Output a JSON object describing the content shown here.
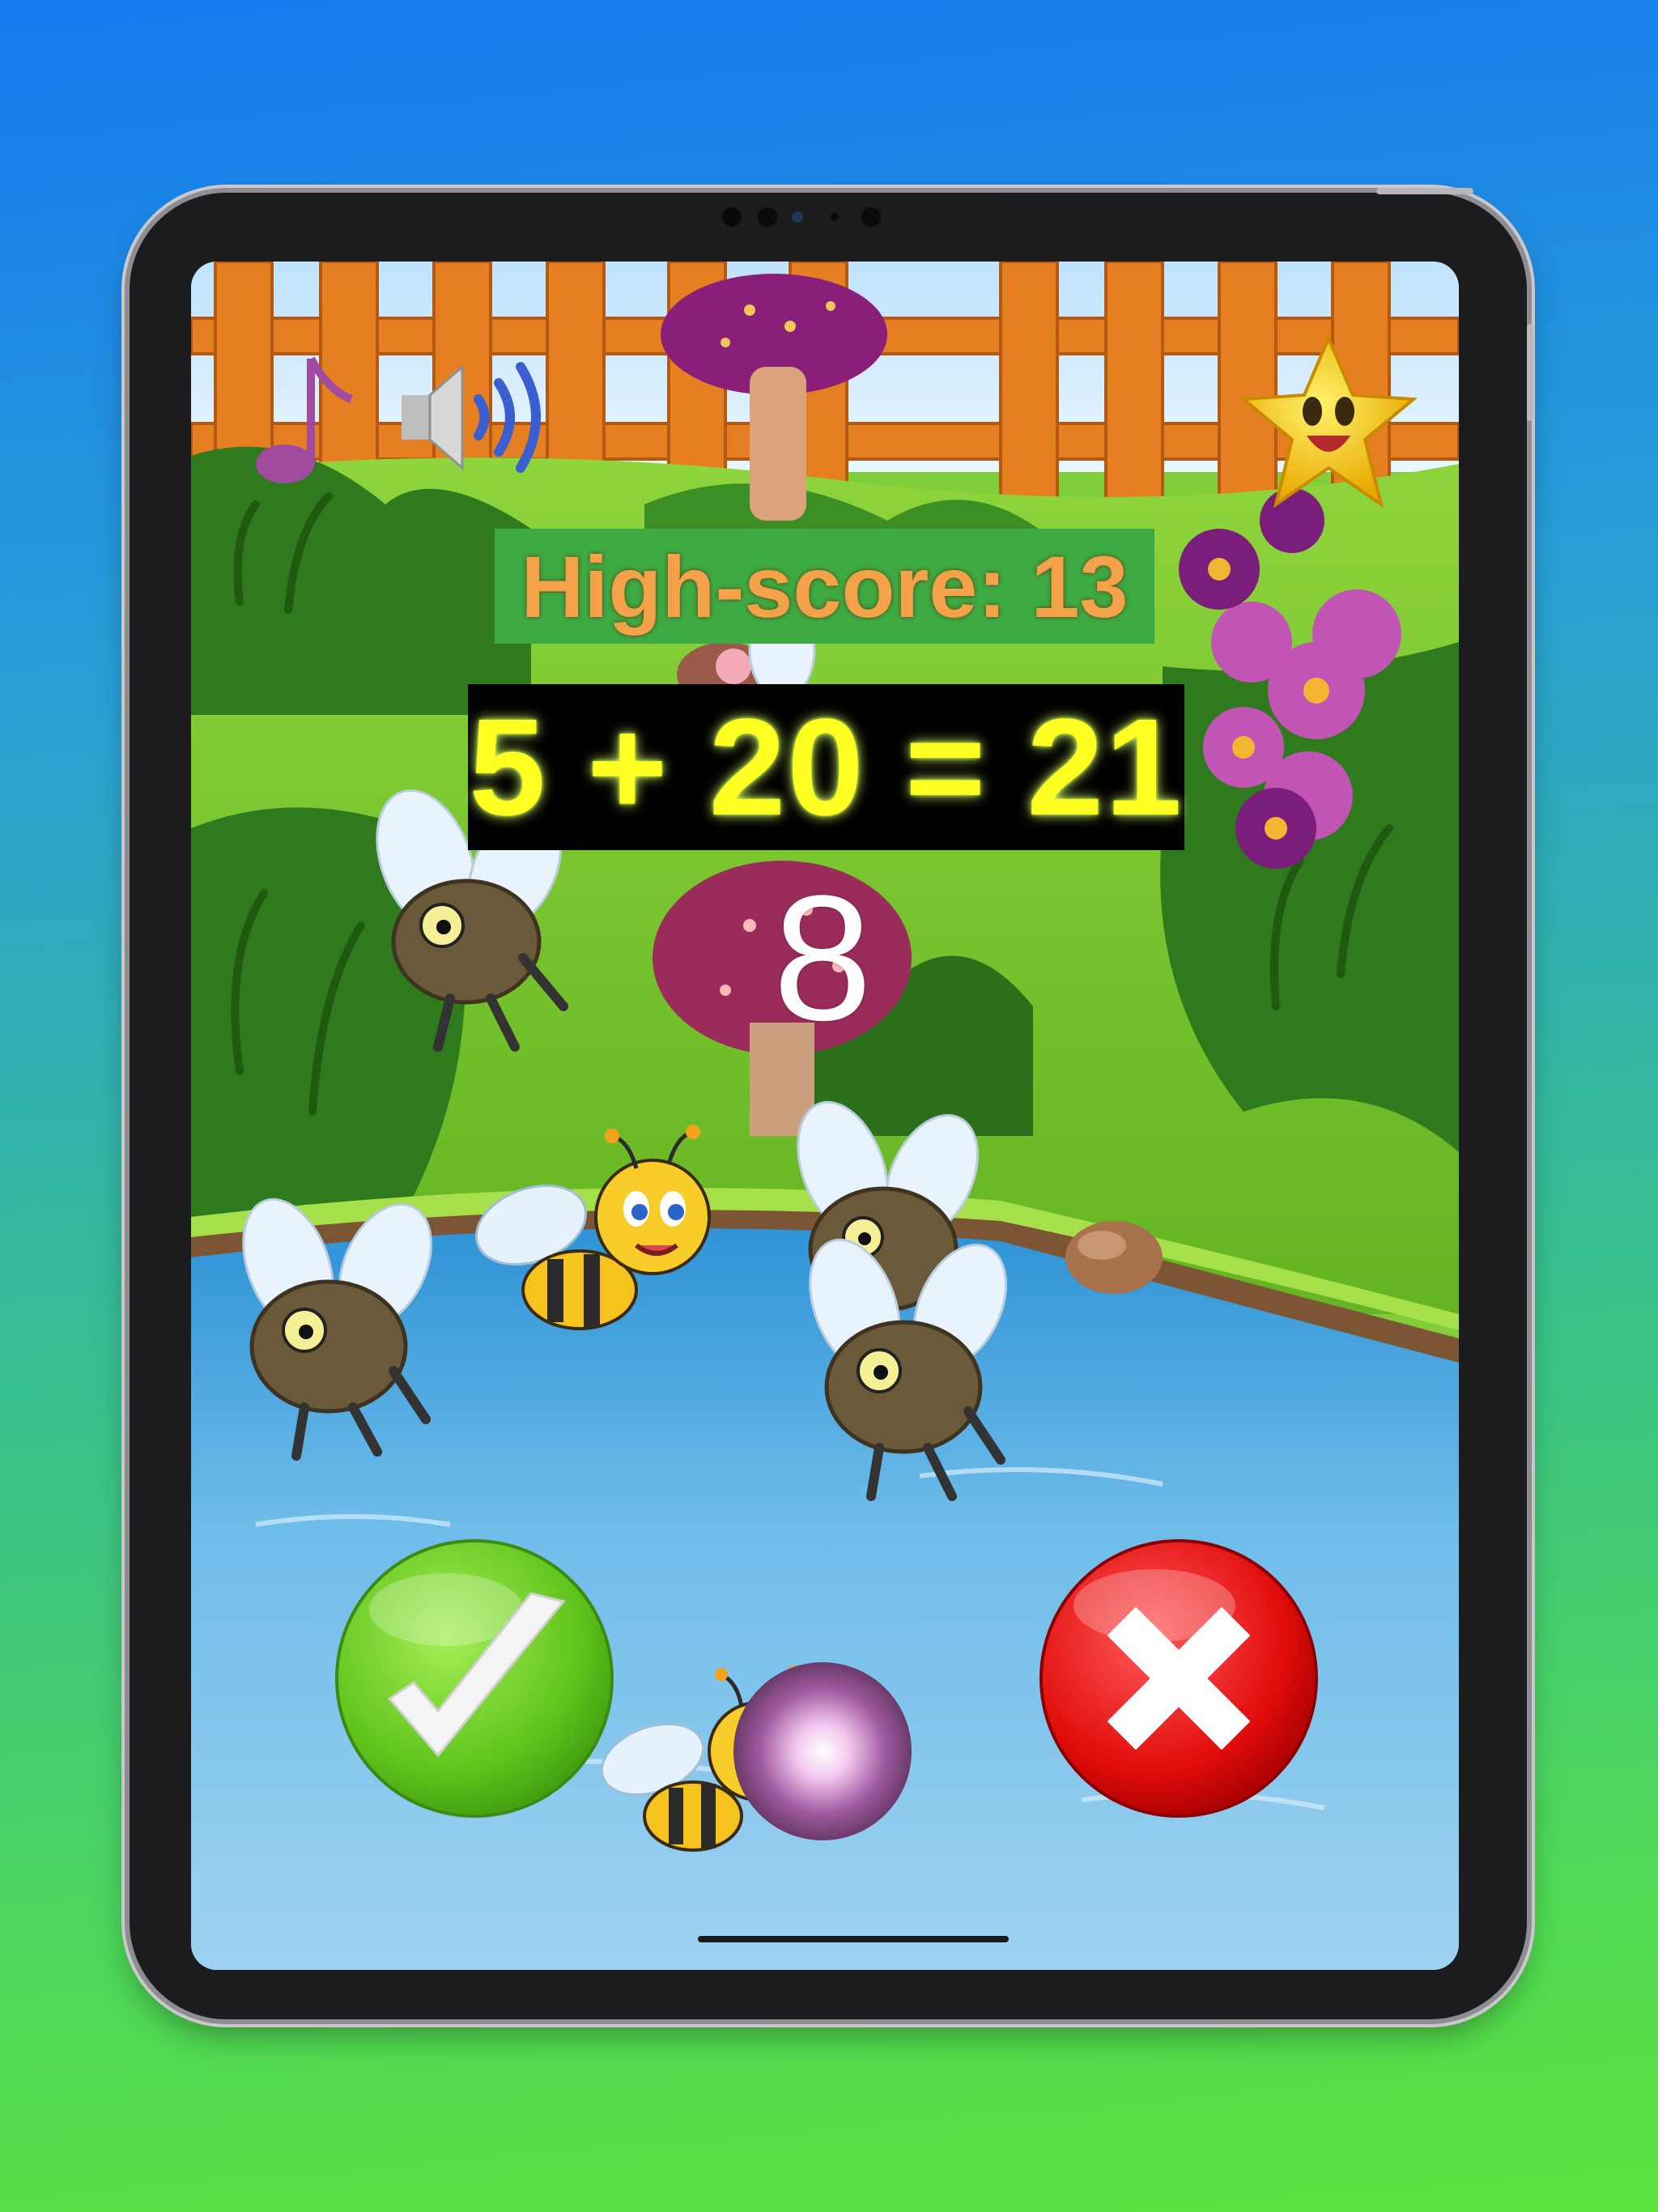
{
  "game": {
    "high_score_text": "High-score: 13",
    "equation_text": "5 + 20 = 21",
    "timer_value": "8"
  },
  "controls": {
    "music_icon": "music-note-icon",
    "sound_icon": "speaker-icon",
    "star_icon": "star-icon",
    "correct_icon": "check-mark-icon",
    "wrong_icon": "x-mark-icon"
  },
  "colors": {
    "high_score_bg": "#3dab42",
    "high_score_text": "#f3a24a",
    "equation_bg": "#000000",
    "equation_text": "#ffff22",
    "correct_button": "#6fd22a",
    "wrong_button": "#e30d0d"
  }
}
